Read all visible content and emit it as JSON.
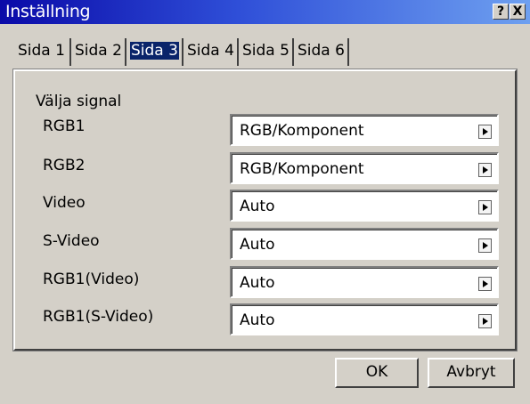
{
  "window": {
    "title": "Inställning",
    "help_glyph": "?",
    "close_glyph": "X"
  },
  "tabs": [
    {
      "label": "Sida 1",
      "selected": false
    },
    {
      "label": "Sida 2",
      "selected": false
    },
    {
      "label": "Sida 3",
      "selected": true
    },
    {
      "label": "Sida 4",
      "selected": false
    },
    {
      "label": "Sida 5",
      "selected": false
    },
    {
      "label": "Sida 6",
      "selected": false
    }
  ],
  "group_title": "Välja signal",
  "rows": [
    {
      "label": "RGB1",
      "value": "RGB/Komponent"
    },
    {
      "label": "RGB2",
      "value": "RGB/Komponent"
    },
    {
      "label": "Video",
      "value": "Auto"
    },
    {
      "label": "S-Video",
      "value": "Auto"
    },
    {
      "label": "RGB1(Video)",
      "value": "Auto"
    },
    {
      "label": "RGB1(S-Video)",
      "value": "Auto"
    }
  ],
  "buttons": {
    "ok": "OK",
    "cancel": "Avbryt"
  },
  "colors": {
    "title_gradient_start": "#0a0aa8",
    "title_gradient_end": "#6ea0f0",
    "selected_tab": "#0a246a",
    "face": "#d4d0c8"
  }
}
